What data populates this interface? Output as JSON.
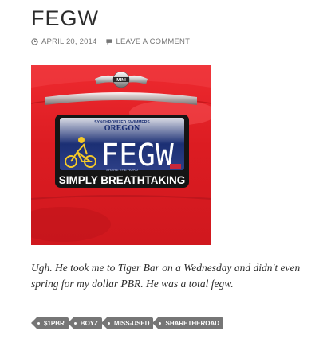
{
  "post": {
    "title": "FEGW",
    "date": "APRIL 20, 2014",
    "comment_link": "LEAVE A COMMENT",
    "content": "Ugh.  He took me to Tiger Bar on a Wednesday and didn't even spring for my dollar PBR.  He was a total fegw."
  },
  "image": {
    "logo_text": "MINI",
    "plate_top": "SYNCHRONIZED SWIMMERS",
    "plate_state": "OREGON",
    "plate_number": "FEGW",
    "frame_slogan": "SIMPLY BREATHTAKING",
    "plate_bottom": "SHARE THE ROAD"
  },
  "tags": [
    "$1PBR",
    "BOYZ",
    "MISS-USED",
    "SHARETHEROAD"
  ],
  "colors": {
    "car_red": "#e21f25",
    "tag_bg": "#767676",
    "meta_text": "#767676"
  }
}
